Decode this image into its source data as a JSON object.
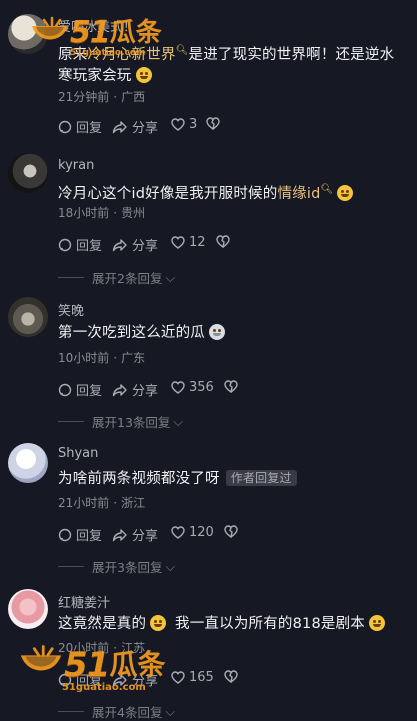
{
  "comments": [
    {
      "username": "爱喝冰美式！",
      "text_before": "原来",
      "text_link": "冷月心新世界",
      "text_after": "是进了现实的世界啊！还是逆水寒玩家会玩",
      "emoji": "grin-emoji",
      "time": "21分钟前",
      "location": "广西",
      "reply_label": "回复",
      "share_label": "分享",
      "likes": "3"
    },
    {
      "username": "kyran",
      "text_before": "冷月心这个id好像是我开服时候的",
      "text_link": "情缘id",
      "emoji": "shy-emoji",
      "time": "18小时前",
      "location": "贵州",
      "reply_label": "回复",
      "share_label": "分享",
      "likes": "12",
      "expand_label": "展开2条回复"
    },
    {
      "username": "笑晚",
      "text_before": "第一次吃到这么近的瓜",
      "emoji": "melon-emoji",
      "time": "10小时前",
      "location": "广东",
      "reply_label": "回复",
      "share_label": "分享",
      "likes": "356",
      "expand_label": "展开13条回复"
    },
    {
      "username": "Shyan",
      "text_before": "为啥前两条视频都没了呀",
      "author_tag": "作者回复过",
      "time": "21小时前",
      "location": "浙江",
      "reply_label": "回复",
      "share_label": "分享",
      "likes": "120",
      "expand_label": "展开3条回复"
    },
    {
      "username": "红糖姜汁",
      "text_before": "这竟然是真的",
      "text_mid": "我一直以为所有的818是剧本",
      "emoji": "laugh-emoji",
      "time": "20小时前",
      "location": "江苏",
      "reply_label": "回复",
      "share_label": "分享",
      "likes": "165",
      "expand_label": "展开4条回复"
    }
  ],
  "watermark": {
    "num": "51",
    "cn": "瓜条",
    "url": "51guatiao.com"
  },
  "colors": {
    "background": "#161823",
    "highlight": "#e7c279",
    "watermark": "#f49b1e"
  }
}
